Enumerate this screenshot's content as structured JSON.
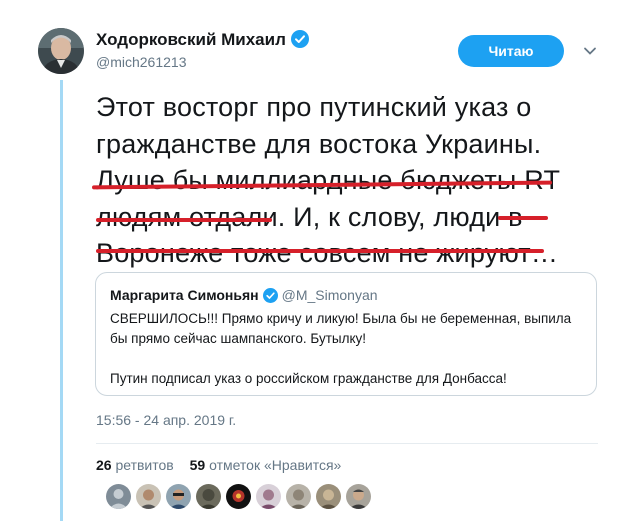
{
  "author": {
    "name": "Ходорковский Михаил",
    "handle": "@mich261213",
    "verified": true,
    "avatar_icon": "user-avatar"
  },
  "follow_button": {
    "label": "Читаю"
  },
  "tweet": {
    "lines": [
      "Этот восторг про путинский указ о",
      "гражданстве для востока Украины.",
      "Луше бы миллиардные бюджеты RT",
      "людям отдали. И, к слову, люди в",
      "Воронеже тоже совсем не жируют…"
    ]
  },
  "quoted_tweet": {
    "name": "Маргарита Симоньян",
    "handle": "@M_Simonyan",
    "verified": true,
    "paragraph1_lines": [
      "СВЕРШИЛОСЬ!!! Прямо кричу и ликую! Была бы не беременная, выпила",
      "бы прямо сейчас шампанского. Бутылку!"
    ],
    "paragraph2": "Путин подписал указ о российском гражданстве для Донбасса!"
  },
  "timestamp": "15:56 - 24 апр. 2019 г.",
  "stats": {
    "retweets_count": "26",
    "retweets_label": "ретвитов",
    "likes_count": "59",
    "likes_label": "отметок «Нравится»"
  },
  "colors": {
    "accent": "#1da1f2",
    "underline": "#d6202a",
    "thread_line": "#a4d9f5",
    "secondary_text": "#657786"
  }
}
